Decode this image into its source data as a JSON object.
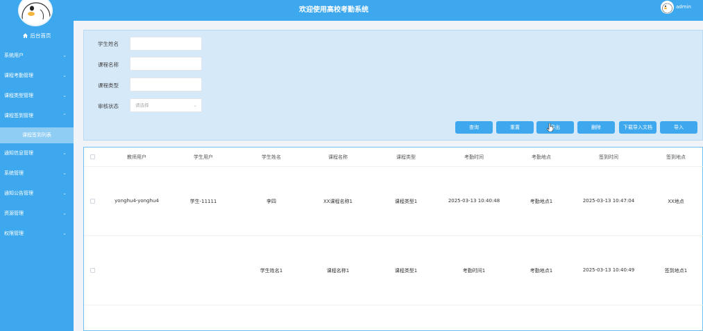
{
  "app": {
    "title": "欢迎使用高校考勤系统",
    "user": "admin"
  },
  "sidebar": {
    "home_label": "后台首页",
    "items": [
      {
        "label": "系统用户"
      },
      {
        "label": "课程考勤管理"
      },
      {
        "label": "课程类型管理"
      },
      {
        "label": "课程签到管理"
      },
      {
        "label": "课程签到列表"
      },
      {
        "label": "通知信息管理"
      },
      {
        "label": "系统管理"
      },
      {
        "label": "通知公告管理"
      },
      {
        "label": "资源管理"
      },
      {
        "label": "权限管理"
      }
    ]
  },
  "search": {
    "fields": [
      {
        "label": "学生姓名",
        "value": ""
      },
      {
        "label": "课程名称",
        "value": ""
      },
      {
        "label": "课程类型",
        "value": ""
      },
      {
        "label": "审核状态",
        "placeholder": "请选择"
      }
    ],
    "buttons": [
      "查询",
      "重置",
      "导出",
      "删除",
      "下载导入文档",
      "导入"
    ]
  },
  "table": {
    "columns": [
      "教师用户",
      "学生用户",
      "学生姓名",
      "课程名称",
      "课程类型",
      "考勤时间",
      "考勤地点",
      "签到时间",
      "签到地点"
    ],
    "rows": [
      [
        "yonghu4-yonghu4",
        "学生-11111",
        "李四",
        "XX课程名称1",
        "课程类型1",
        "2025-03-13 10:40:48",
        "考勤地点1",
        "2025-03-13 10:47:04",
        "XX地点"
      ],
      [
        "",
        "",
        "学生姓名1",
        "课程名称1",
        "课程类型1",
        "考勤时间1",
        "考勤地点1",
        "2025-03-13 10:40:49",
        "签到地点1"
      ]
    ]
  },
  "colors": {
    "primary": "#3da8ee",
    "panel": "#d6e9f8",
    "submenu_active": "#8fcdf4"
  }
}
